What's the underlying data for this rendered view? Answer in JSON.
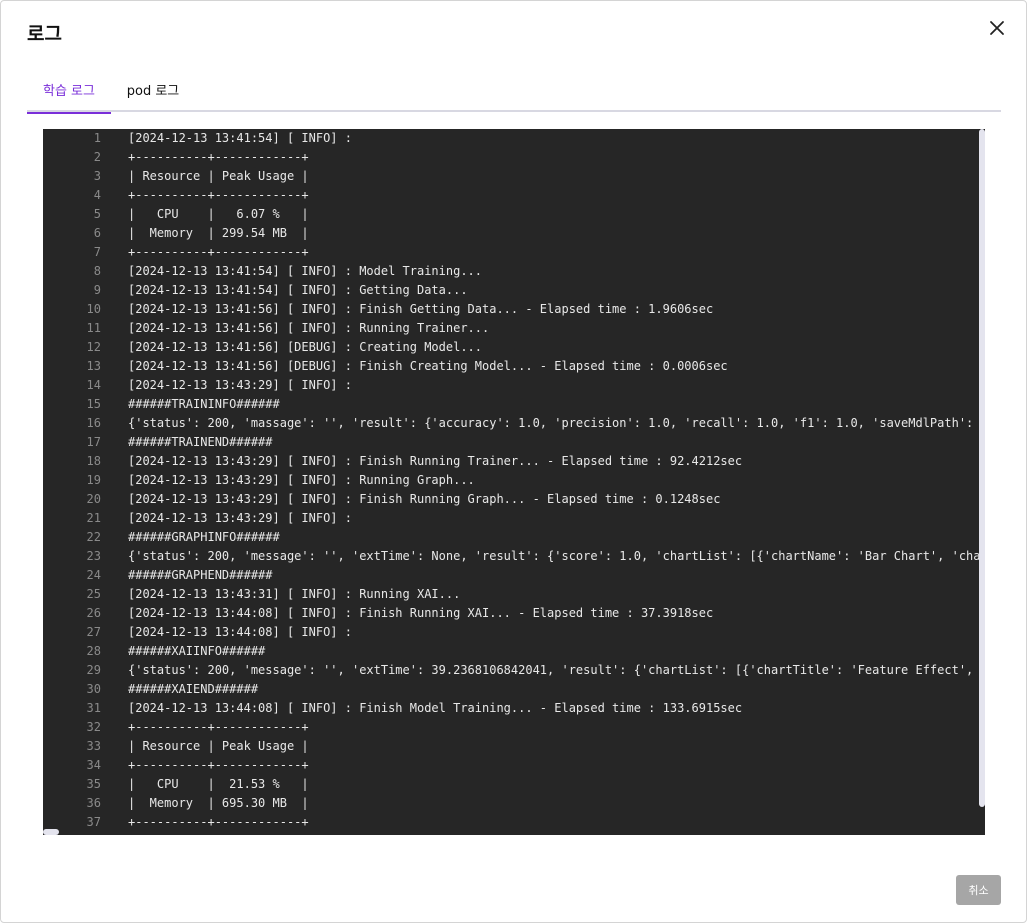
{
  "modal": {
    "title": "로그",
    "close_icon": "close-icon",
    "cancel_label": "취소"
  },
  "tabs": [
    {
      "label": "학습 로그",
      "active": true
    },
    {
      "label": "pod 로그",
      "active": false
    }
  ],
  "colors": {
    "accent": "#7a2fd9",
    "log_bg": "#262626",
    "cancel_bg": "#a6a6a6"
  },
  "log_lines": [
    {
      "n": "1",
      "text": "[2024-12-13 13:41:54] [ INFO] :"
    },
    {
      "n": "2",
      "text": "+----------+------------+"
    },
    {
      "n": "3",
      "text": "| Resource | Peak Usage |"
    },
    {
      "n": "4",
      "text": "+----------+------------+"
    },
    {
      "n": "5",
      "text": "|   CPU    |   6.07 %   |"
    },
    {
      "n": "6",
      "text": "|  Memory  | 299.54 MB  |"
    },
    {
      "n": "7",
      "text": "+----------+------------+"
    },
    {
      "n": "8",
      "text": "[2024-12-13 13:41:54] [ INFO] : Model Training..."
    },
    {
      "n": "9",
      "text": "[2024-12-13 13:41:54] [ INFO] : Getting Data..."
    },
    {
      "n": "10",
      "text": "[2024-12-13 13:41:56] [ INFO] : Finish Getting Data... - Elapsed time : 1.9606sec"
    },
    {
      "n": "11",
      "text": "[2024-12-13 13:41:56] [ INFO] : Running Trainer..."
    },
    {
      "n": "12",
      "text": "[2024-12-13 13:41:56] [DEBUG] : Creating Model..."
    },
    {
      "n": "13",
      "text": "[2024-12-13 13:41:56] [DEBUG] : Finish Creating Model... - Elapsed time : 0.0006sec"
    },
    {
      "n": "14",
      "text": "[2024-12-13 13:43:29] [ INFO] :"
    },
    {
      "n": "15",
      "text": "######TRAININFO######"
    },
    {
      "n": "16",
      "text": "{'status': 200, 'massage': '', 'result': {'accuracy': 1.0, 'precision': 1.0, 'recall': 1.0, 'f1': 1.0, 'saveMdlPath':"
    },
    {
      "n": "17",
      "text": "######TRAINEND######"
    },
    {
      "n": "18",
      "text": "[2024-12-13 13:43:29] [ INFO] : Finish Running Trainer... - Elapsed time : 92.4212sec"
    },
    {
      "n": "19",
      "text": "[2024-12-13 13:43:29] [ INFO] : Running Graph..."
    },
    {
      "n": "20",
      "text": "[2024-12-13 13:43:29] [ INFO] : Finish Running Graph... - Elapsed time : 0.1248sec"
    },
    {
      "n": "21",
      "text": "[2024-12-13 13:43:29] [ INFO] :"
    },
    {
      "n": "22",
      "text": "######GRAPHINFO######"
    },
    {
      "n": "23",
      "text": "{'status': 200, 'message': '', 'extTime': None, 'result': {'score': 1.0, 'chartList': [{'chartName': 'Bar Chart', 'cha"
    },
    {
      "n": "24",
      "text": "######GRAPHEND######"
    },
    {
      "n": "25",
      "text": "[2024-12-13 13:43:31] [ INFO] : Running XAI..."
    },
    {
      "n": "26",
      "text": "[2024-12-13 13:44:08] [ INFO] : Finish Running XAI... - Elapsed time : 37.3918sec"
    },
    {
      "n": "27",
      "text": "[2024-12-13 13:44:08] [ INFO] :"
    },
    {
      "n": "28",
      "text": "######XAIINFO######"
    },
    {
      "n": "29",
      "text": "{'status': 200, 'message': '', 'extTime': 39.2368106842041, 'result': {'chartList': [{'chartTitle': 'Feature Effect',"
    },
    {
      "n": "30",
      "text": "######XAIEND######"
    },
    {
      "n": "31",
      "text": "[2024-12-13 13:44:08] [ INFO] : Finish Model Training... - Elapsed time : 133.6915sec"
    },
    {
      "n": "32",
      "text": "+----------+------------+"
    },
    {
      "n": "33",
      "text": "| Resource | Peak Usage |"
    },
    {
      "n": "34",
      "text": "+----------+------------+"
    },
    {
      "n": "35",
      "text": "|   CPU    |  21.53 %   |"
    },
    {
      "n": "36",
      "text": "|  Memory  | 695.30 MB  |"
    },
    {
      "n": "37",
      "text": "+----------+------------+"
    }
  ]
}
